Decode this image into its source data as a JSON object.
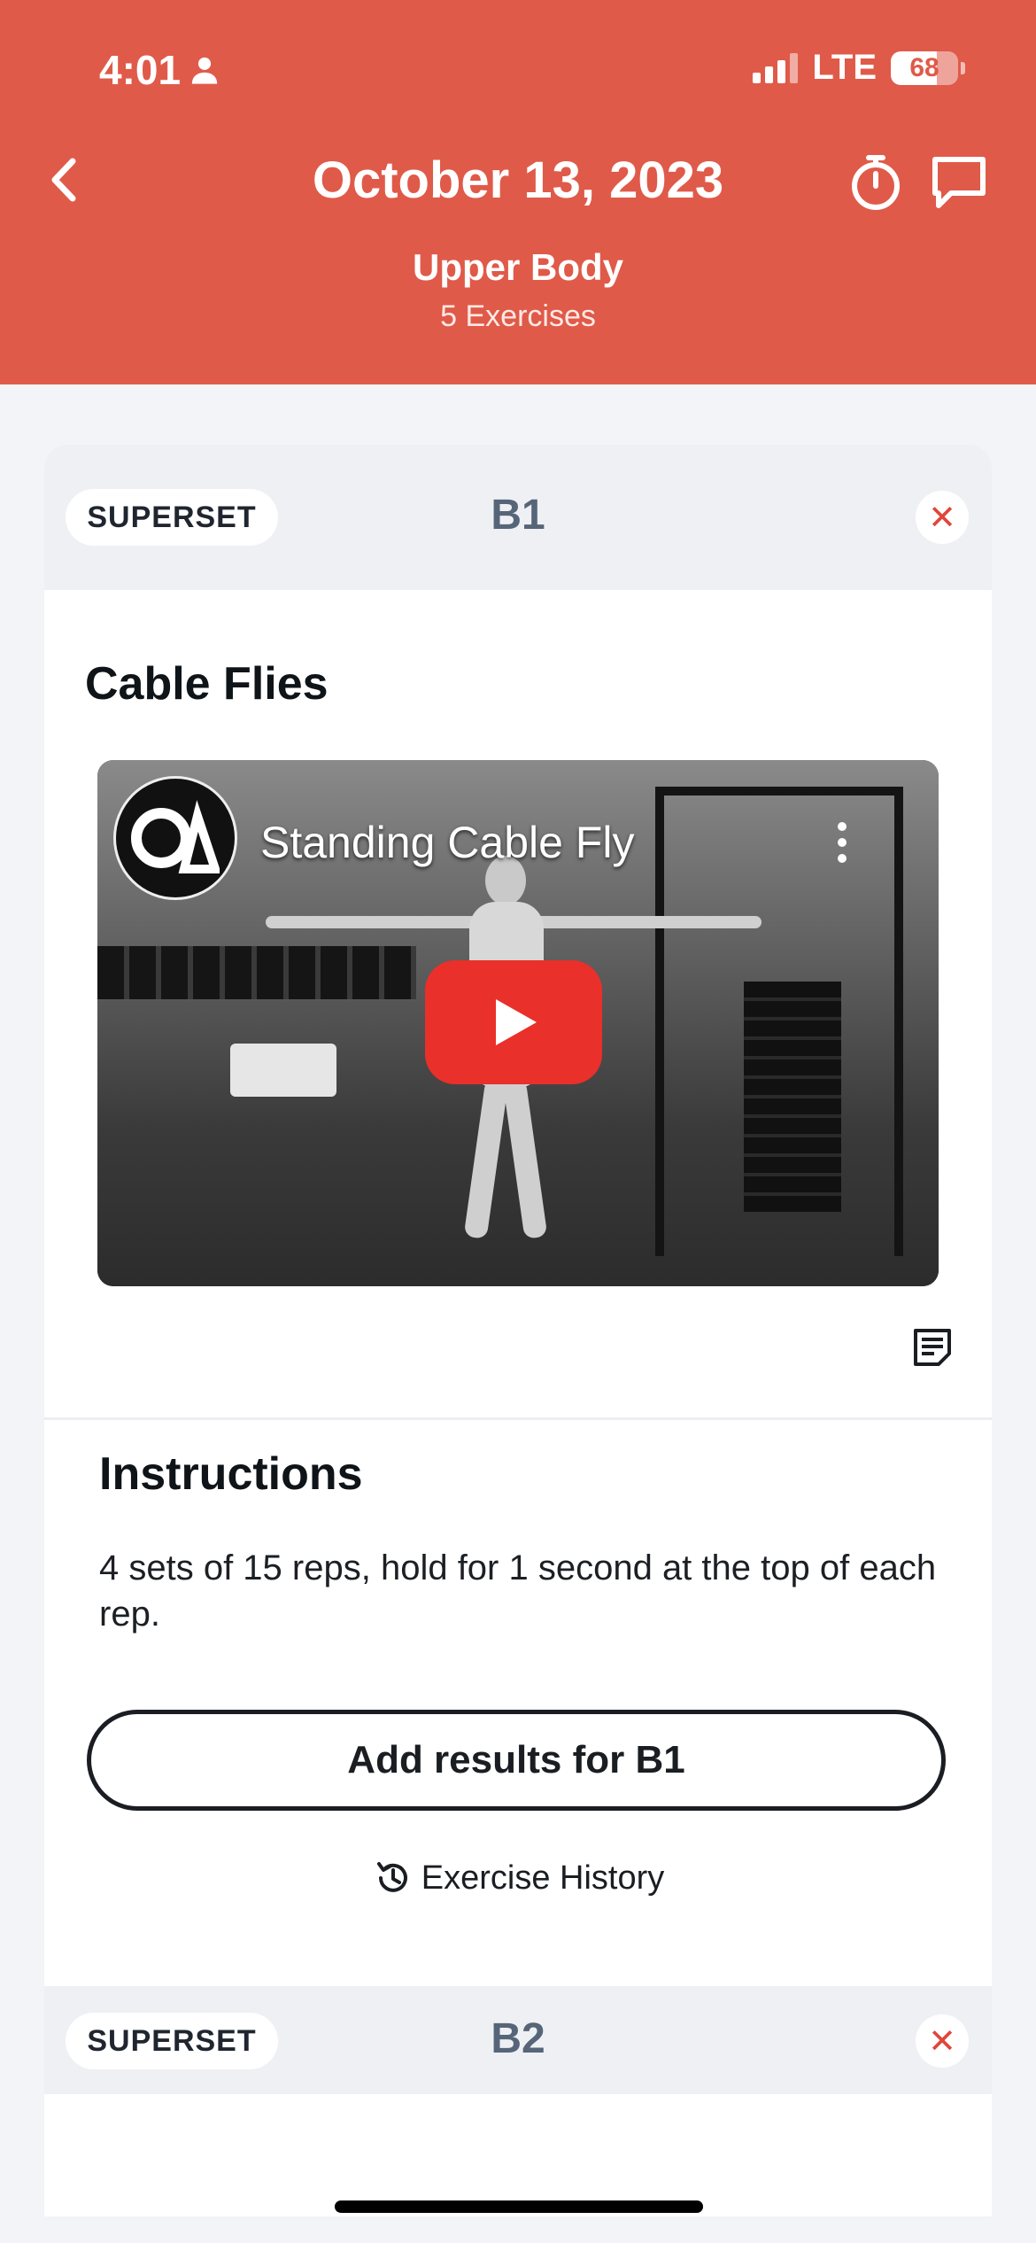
{
  "status_bar": {
    "time": "4:01",
    "network": "LTE",
    "battery": "68",
    "battery_level": 0.68
  },
  "header": {
    "date": "October 13, 2023",
    "workout_name": "Upper Body",
    "exercise_count": "5 Exercises"
  },
  "supersets": [
    {
      "tag": "SUPERSET",
      "label": "B1"
    },
    {
      "tag": "SUPERSET",
      "label": "B2"
    }
  ],
  "exercise": {
    "name": "Cable Flies",
    "video_title": "Standing Cable Fly",
    "instructions_heading": "Instructions",
    "instructions": "4 sets of 15 reps, hold for 1 second at the top of each rep.",
    "add_results_label": "Add results for B1",
    "history_label": "Exercise History"
  },
  "colors": {
    "header": "#e05a49",
    "close": "#e0463b",
    "play": "#e9302a"
  }
}
